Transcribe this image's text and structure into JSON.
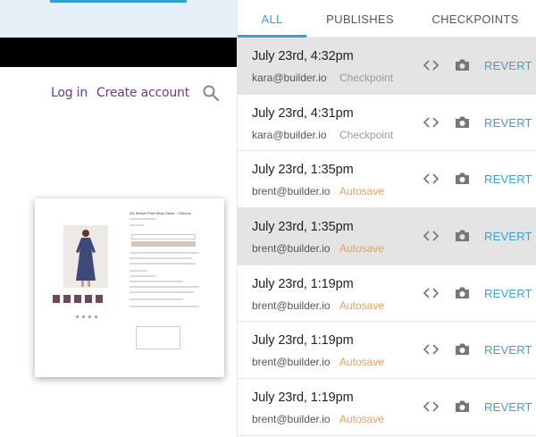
{
  "preview": {
    "nav": {
      "login": "Log in",
      "create_account": "Create account"
    },
    "product_title": "3/4 Sleeve Print Wrap Dress - Chevron"
  },
  "panel": {
    "tabs": [
      {
        "label": "ALL",
        "active": true
      },
      {
        "label": "PUBLISHES",
        "active": false
      },
      {
        "label": "CHECKPOINTS",
        "active": false
      }
    ],
    "rows": [
      {
        "date": "July 23rd, 4:32pm",
        "user": "kara@builder.io",
        "kind": "Checkpoint",
        "action": "REVERT"
      },
      {
        "date": "July 23rd, 4:31pm",
        "user": "kara@builder.io",
        "kind": "Checkpoint",
        "action": "REVERT"
      },
      {
        "date": "July 23rd, 1:35pm",
        "user": "brent@builder.io",
        "kind": "Autosave",
        "action": "REVERT"
      },
      {
        "date": "July 23rd, 1:35pm",
        "user": "brent@builder.io",
        "kind": "Autosave",
        "action": "REVERT"
      },
      {
        "date": "July 23rd, 1:19pm",
        "user": "brent@builder.io",
        "kind": "Autosave",
        "action": "REVERT"
      },
      {
        "date": "July 23rd, 1:19pm",
        "user": "brent@builder.io",
        "kind": "Autosave",
        "action": "REVERT"
      },
      {
        "date": "July 23rd, 1:19pm",
        "user": "brent@builder.io",
        "kind": "Autosave",
        "action": "REVERT"
      }
    ]
  },
  "colors": {
    "accent": "#3c9fd3",
    "autosave": "#e9a053",
    "checkpoint": "#9a9a9a",
    "highlight_row": "#e4e4e4",
    "link_purple": "#6b3a8a"
  },
  "icons": {
    "code": "code-brackets-icon",
    "camera": "camera-icon",
    "search": "search-icon"
  }
}
